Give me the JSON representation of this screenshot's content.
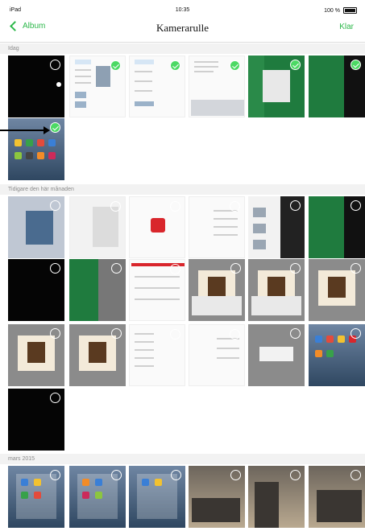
{
  "status": {
    "device": "iPad",
    "time": "10:35",
    "battery": "100 %"
  },
  "nav": {
    "back_label": "Album",
    "title": "Kamerarulle",
    "done_label": "Klar"
  },
  "sections": [
    {
      "title": "Idag"
    },
    {
      "title": "Tidigare den här månaden"
    },
    {
      "title": "mars 2015"
    }
  ],
  "colors": {
    "accent": "#2db84b",
    "selected": "#4cd964"
  }
}
